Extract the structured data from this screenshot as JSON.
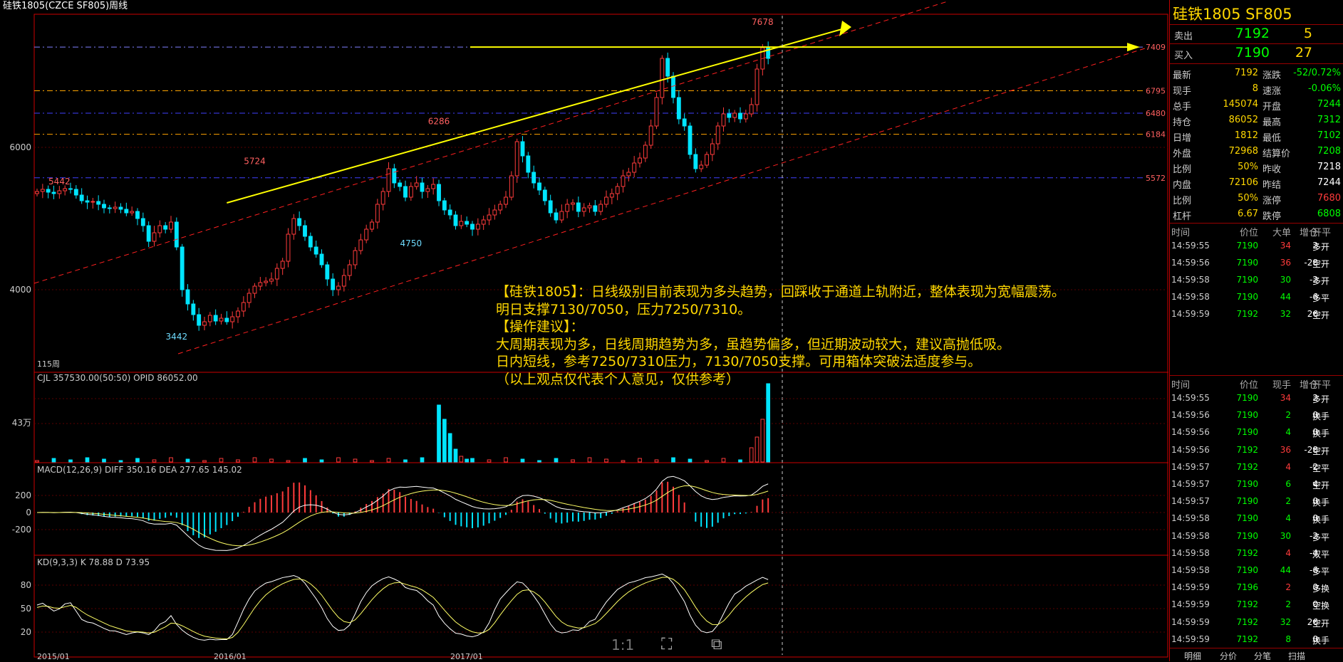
{
  "window": {
    "title": "硅铁1805(CZCE SF805)周线"
  },
  "colors": {
    "up": "#ff3b3b",
    "down": "#00e5ff",
    "axis": "#cc0000",
    "trend": "#ffff00",
    "text": "#cccccc",
    "yellow": "#ffd700"
  },
  "chart_data": {
    "type": "candlestick",
    "main_axis": {
      "ticks": [
        6000,
        4000
      ],
      "ylim": [
        2850,
        7850
      ]
    },
    "x_ticks": [
      "2015/01",
      "2016/01",
      "2017/01"
    ],
    "price_labels": [
      "7678",
      "6286",
      "5724",
      "5442",
      "4750",
      "3442"
    ],
    "level_labels": [
      "7409",
      "6795",
      "6480",
      "6184",
      "5572"
    ],
    "bar_count_label": "115周",
    "closes": [
      5380,
      5410,
      5370,
      5350,
      5390,
      5420,
      5410,
      5330,
      5250,
      5230,
      5240,
      5200,
      5150,
      5140,
      5160,
      5130,
      5080,
      5100,
      5000,
      4900,
      4680,
      4800,
      4900,
      4850,
      4950,
      4600,
      4000,
      3800,
      3650,
      3500,
      3550,
      3640,
      3560,
      3600,
      3550,
      3620,
      3700,
      3820,
      3950,
      4050,
      4100,
      4120,
      4150,
      4300,
      4400,
      4780,
      5000,
      4900,
      4750,
      4600,
      4500,
      4350,
      4150,
      4000,
      4050,
      4200,
      4350,
      4550,
      4700,
      4850,
      4950,
      5200,
      5380,
      5700,
      5500,
      5450,
      5300,
      5450,
      5500,
      5380,
      5420,
      5480,
      5250,
      5120,
      5050,
      4900,
      4960,
      4920,
      4850,
      4920,
      4980,
      5050,
      5120,
      5200,
      5300,
      5600,
      6080,
      5880,
      5650,
      5500,
      5400,
      5250,
      5080,
      4980,
      5100,
      5200,
      5220,
      5100,
      5150,
      5180,
      5100,
      5200,
      5300,
      5350,
      5450,
      5600,
      5650,
      5780,
      5850,
      6030,
      6300,
      6700,
      7250,
      7000,
      6700,
      6400,
      6300,
      5900,
      5700,
      5750,
      5900,
      6050,
      6300,
      6470,
      6420,
      6480,
      6400,
      6470,
      6600,
      7100,
      7400,
      7250
    ],
    "main_trend": "7409",
    "cjl": {
      "label": "CJL",
      "value": "357530.00(50:50)",
      "opid_label": "OPID",
      "opid": "86052.00",
      "tick": "43万"
    },
    "macd": {
      "label": "MACD(12,26,9)",
      "diff_label": "DIFF",
      "diff": "350.16",
      "dea_label": "DEA",
      "dea": "277.65",
      "macd": "145.02",
      "ticks": [
        "200",
        "0",
        "-200"
      ]
    },
    "kd": {
      "label": "KD(9,3,3)",
      "k_label": "K",
      "k": "78.88",
      "d_label": "D",
      "d": "73.95",
      "ticks": [
        "80",
        "50",
        "20"
      ]
    }
  },
  "quote": {
    "title": "硅铁1805 SF805",
    "sell_label": "卖出",
    "sell_price": "7192",
    "sell_vol": "5",
    "buy_label": "买入",
    "buy_price": "7190",
    "buy_vol": "27",
    "rows": [
      {
        "l1": "最新",
        "v1": "7192",
        "c1": "#ffd700",
        "l2": "涨跌",
        "v2": "-52/0.72%",
        "c2": "#00ff00"
      },
      {
        "l1": "现手",
        "v1": "8",
        "c1": "#ffd700",
        "l2": "速涨",
        "v2": "-0.06%",
        "c2": "#00ff00"
      },
      {
        "l1": "总手",
        "v1": "145074",
        "c1": "#ffd700",
        "l2": "开盘",
        "v2": "7244",
        "c2": "#00ff00"
      },
      {
        "l1": "持仓",
        "v1": "86052",
        "c1": "#ffd700",
        "l2": "最高",
        "v2": "7312",
        "c2": "#00ff00"
      },
      {
        "l1": "日增",
        "v1": "1812",
        "c1": "#ffd700",
        "l2": "最低",
        "v2": "7102",
        "c2": "#00ff00"
      },
      {
        "l1": "外盘",
        "v1": "72968",
        "c1": "#ffd700",
        "l2": "结算价",
        "v2": "7208",
        "c2": "#00ff00"
      },
      {
        "l1": "比例",
        "v1": "50%",
        "c1": "#ffd700",
        "l2": "昨收",
        "v2": "7218",
        "c2": "#ffffff"
      },
      {
        "l1": "内盘",
        "v1": "72106",
        "c1": "#ffd700",
        "l2": "昨结",
        "v2": "7244",
        "c2": "#ffffff"
      },
      {
        "l1": "比例",
        "v1": "50%",
        "c1": "#ffd700",
        "l2": "涨停",
        "v2": "7680",
        "c2": "#ff3b3b"
      },
      {
        "l1": "杠杆",
        "v1": "6.67",
        "c1": "#ffd700",
        "l2": "跌停",
        "v2": "6808",
        "c2": "#00ff00"
      }
    ]
  },
  "ticks1": {
    "headers": [
      "时间",
      "价位",
      "大单",
      "增仓",
      "开平"
    ],
    "rows": [
      {
        "time": "14:59:55",
        "price": "7190",
        "vol": "34",
        "oi": "2",
        "type": "多开",
        "vc": "#ff3b3b"
      },
      {
        "time": "14:59:56",
        "price": "7190",
        "vol": "36",
        "oi": "-28",
        "type": "空开",
        "vc": "#ff3b3b"
      },
      {
        "time": "14:59:58",
        "price": "7190",
        "vol": "30",
        "oi": "-2",
        "type": "多开",
        "vc": "#00ff00"
      },
      {
        "time": "14:59:58",
        "price": "7190",
        "vol": "44",
        "oi": "-6",
        "type": "多平",
        "vc": "#00ff00"
      },
      {
        "time": "14:59:59",
        "price": "7192",
        "vol": "32",
        "oi": "26",
        "type": "空开",
        "vc": "#00ff00"
      }
    ]
  },
  "ticks2": {
    "headers": [
      "时间",
      "价位",
      "现手",
      "增仓",
      "开平"
    ],
    "rows": [
      {
        "time": "14:59:55",
        "price": "7190",
        "vol": "34",
        "oi": "2",
        "type": "多开",
        "vc": "#ff3b3b"
      },
      {
        "time": "14:59:56",
        "price": "7190",
        "vol": "2",
        "oi": "0",
        "type": "换手",
        "vc": "#00ff00"
      },
      {
        "time": "14:59:56",
        "price": "7190",
        "vol": "4",
        "oi": "0",
        "type": "换手",
        "vc": "#00ff00"
      },
      {
        "time": "14:59:56",
        "price": "7192",
        "vol": "36",
        "oi": "-28",
        "type": "空开",
        "vc": "#ff3b3b"
      },
      {
        "time": "14:59:57",
        "price": "7192",
        "vol": "4",
        "oi": "-2",
        "type": "空平",
        "vc": "#ff3b3b"
      },
      {
        "time": "14:59:57",
        "price": "7190",
        "vol": "6",
        "oi": "4",
        "type": "空开",
        "vc": "#00ff00"
      },
      {
        "time": "14:59:57",
        "price": "7190",
        "vol": "2",
        "oi": "0",
        "type": "换手",
        "vc": "#00ff00"
      },
      {
        "time": "14:59:58",
        "price": "7190",
        "vol": "4",
        "oi": "0",
        "type": "换手",
        "vc": "#00ff00"
      },
      {
        "time": "14:59:58",
        "price": "7190",
        "vol": "30",
        "oi": "-2",
        "type": "多平",
        "vc": "#00ff00"
      },
      {
        "time": "14:59:58",
        "price": "7192",
        "vol": "4",
        "oi": "-4",
        "type": "双平",
        "vc": "#ff3b3b"
      },
      {
        "time": "14:59:58",
        "price": "7190",
        "vol": "44",
        "oi": "-6",
        "type": "多平",
        "vc": "#00ff00"
      },
      {
        "time": "14:59:59",
        "price": "7196",
        "vol": "2",
        "oi": "0",
        "type": "多换",
        "vc": "#ff3b3b"
      },
      {
        "time": "14:59:59",
        "price": "7192",
        "vol": "2",
        "oi": "0",
        "type": "空换",
        "vc": "#00ff00"
      },
      {
        "time": "14:59:59",
        "price": "7192",
        "vol": "32",
        "oi": "26",
        "type": "空开",
        "vc": "#00ff00"
      },
      {
        "time": "14:59:59",
        "price": "7192",
        "vol": "8",
        "oi": "0",
        "type": "换手",
        "vc": "#00ff00"
      }
    ]
  },
  "tabs": [
    "明细",
    "分价",
    "分笔",
    "扫描"
  ],
  "note": [
    "【硅铁1805】：日线级别目前表现为多头趋势，回踩收于通道上轨附近，整体表现为宽幅震荡。",
    "明日支撑7130/7050，压力7250/7310。",
    "【操作建议】：",
    "大周期表现为多，日线周期趋势为多，虽趋势偏多，但近期波动较大，建议高抛低吸。",
    "日内短线，参考7250/7310压力，7130/7050支撑。可用箱体突破法适度参与。",
    "（以上观点仅代表个人意见，仅供参考）"
  ],
  "toolbar": {
    "ratio": "1:1"
  }
}
